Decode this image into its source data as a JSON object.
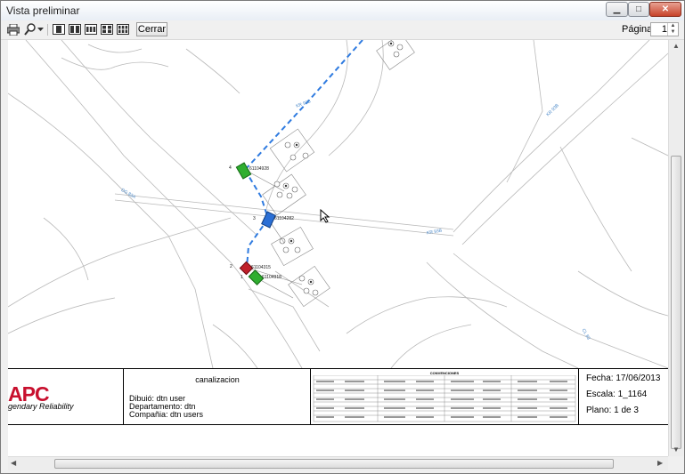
{
  "window": {
    "title": "Vista preliminar"
  },
  "toolbar": {
    "icons": [
      "printer-icon",
      "zoom-icon",
      "dropdown-arrow-icon",
      "one-page-icon",
      "two-pages-icon",
      "three-pages-icon",
      "four-pages-icon",
      "six-pages-icon"
    ],
    "close_label": "Cerrar",
    "page_label": "Página",
    "page_value": "1"
  },
  "map": {
    "street_labels": [
      "KR 93B",
      "DG 83A",
      "KR 93B",
      "CL 83"
    ],
    "markers": [
      {
        "num": "4",
        "code": "61104928",
        "color": "#2fae2f"
      },
      {
        "num": "3",
        "code": "61104282",
        "color": "#2a6fd6"
      },
      {
        "num": "2",
        "code": "61104315",
        "color": "#c0202a"
      },
      {
        "num": "1",
        "code": "61104918",
        "color": "#2fae2f"
      }
    ],
    "link_color": "#2f7be0"
  },
  "title_block": {
    "logo": "APC",
    "tagline": "gendary Reliability",
    "project_title": "canalizacion",
    "drawn_by": "Dibuió: dtn user",
    "department": "Departamento: dtn",
    "company": "Compañia: dtn users",
    "legend_title": "CONVENCIONES",
    "date": "Fecha: 17/06/2013",
    "scale": "Escala: 1_1164",
    "plan": "Plano: 1 de 3"
  },
  "colors": {
    "logo_red": "#c8102e",
    "street_label": "#4a88c8"
  }
}
